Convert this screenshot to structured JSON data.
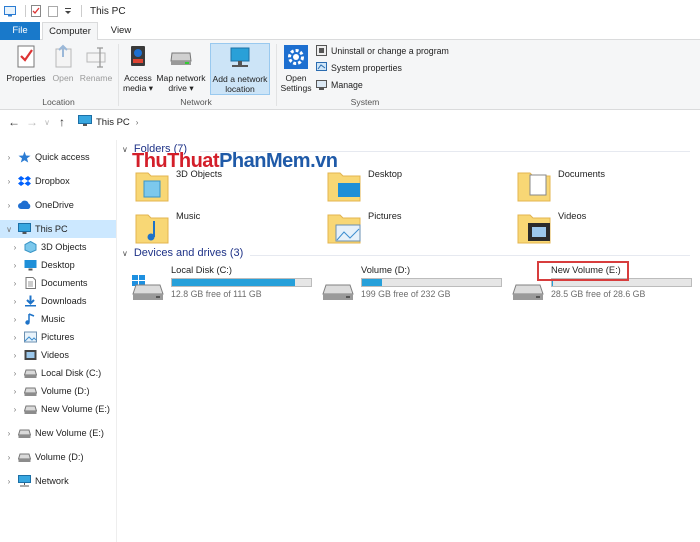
{
  "window": {
    "title": "This PC"
  },
  "ribbon_tabs": {
    "file": "File",
    "computer": "Computer",
    "view": "View"
  },
  "ribbon": {
    "location": {
      "label": "Location",
      "properties": "Properties",
      "open": "Open",
      "rename": "Rename"
    },
    "network": {
      "label": "Network",
      "access_media": "Access media ▾",
      "map_network_drive": "Map network drive ▾",
      "add_network_location": "Add a network location"
    },
    "system": {
      "label": "System",
      "open_settings": "Open Settings",
      "uninstall": "Uninstall or change a program",
      "system_properties": "System properties",
      "manage": "Manage"
    }
  },
  "address": {
    "breadcrumb": "This PC"
  },
  "nav_pane": {
    "items": [
      {
        "label": "Quick access",
        "icon": "star-icon"
      },
      {
        "label": "Dropbox",
        "icon": "dropbox-icon"
      },
      {
        "label": "OneDrive",
        "icon": "cloud-icon"
      },
      {
        "label": "This PC",
        "icon": "computer-icon"
      },
      {
        "label": "3D Objects",
        "icon": "cube-icon"
      },
      {
        "label": "Desktop",
        "icon": "desktop-icon"
      },
      {
        "label": "Documents",
        "icon": "document-icon"
      },
      {
        "label": "Downloads",
        "icon": "download-icon"
      },
      {
        "label": "Music",
        "icon": "music-icon"
      },
      {
        "label": "Pictures",
        "icon": "picture-icon"
      },
      {
        "label": "Videos",
        "icon": "video-icon"
      },
      {
        "label": "Local Disk (C:)",
        "icon": "drive-icon"
      },
      {
        "label": "Volume (D:)",
        "icon": "drive-icon"
      },
      {
        "label": "New Volume (E:)",
        "icon": "drive-icon"
      },
      {
        "label": "New Volume (E:)",
        "icon": "drive-icon"
      },
      {
        "label": "Volume (D:)",
        "icon": "drive-icon"
      },
      {
        "label": "Network",
        "icon": "network-icon"
      }
    ]
  },
  "folders": {
    "header": "Folders (7)",
    "items": [
      {
        "name": "3D Objects"
      },
      {
        "name": "Desktop"
      },
      {
        "name": "Documents"
      },
      {
        "name": "Music"
      },
      {
        "name": "Pictures"
      },
      {
        "name": "Videos"
      }
    ]
  },
  "drives": {
    "header": "Devices and drives (3)",
    "items": [
      {
        "name": "Local Disk (C:)",
        "free_text": "12.8 GB free of 111 GB",
        "used_fraction": 0.885
      },
      {
        "name": "Volume (D:)",
        "free_text": "199 GB free of 232 GB",
        "used_fraction": 0.142
      },
      {
        "name": "New Volume (E:)",
        "free_text": "28.5 GB free of 28.6 GB",
        "used_fraction": 0.004
      }
    ]
  },
  "watermark": {
    "part1": "ThuThuat",
    "part2": "PhanMem",
    "part3": ".vn"
  },
  "colors": {
    "accent": "#1979ca",
    "bar_fill": "#26a0da",
    "selection": "#cce8ff",
    "highlight": "#d73d3d"
  }
}
